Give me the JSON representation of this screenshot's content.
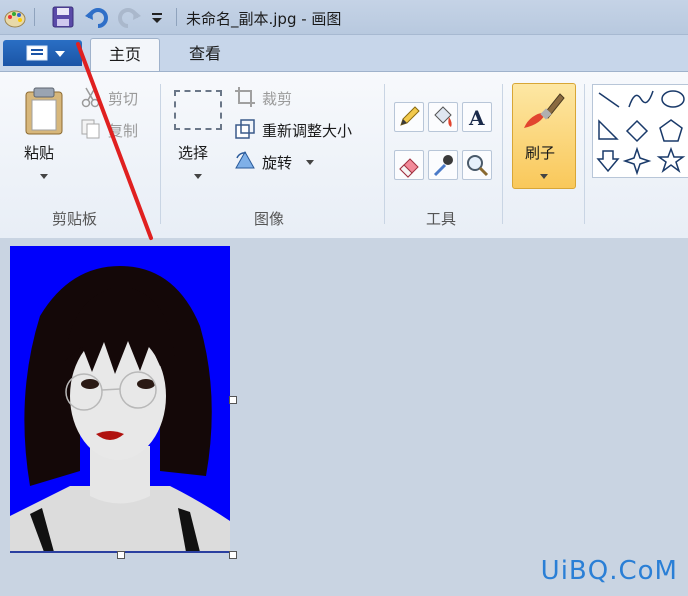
{
  "titlebar": {
    "title": "未命名_副本.jpg - 画图"
  },
  "tabs": {
    "home": "主页",
    "view": "查看"
  },
  "clipboard": {
    "paste": "粘贴",
    "cut": "剪切",
    "copy": "复制",
    "group_label": "剪贴板"
  },
  "image": {
    "select": "选择",
    "crop": "裁剪",
    "resize": "重新调整大小",
    "rotate": "旋转",
    "group_label": "图像"
  },
  "tools": {
    "group_label": "工具"
  },
  "brushes": {
    "label": "刷子"
  },
  "watermark": "UiBQ.CoM",
  "colors": {
    "canvas_background": "#0000fc",
    "brush_highlight": "#f9c85a",
    "app_menu": "#1b54a6",
    "annotation_arrow": "#e02020"
  },
  "icons": {
    "app": "paint-app-icon",
    "save": "save-icon",
    "undo": "undo-icon",
    "redo": "redo-icon",
    "customize": "customize-dropdown-icon",
    "pencil": "pencil-icon",
    "fill": "fill-bucket-icon",
    "text": "text-icon",
    "eraser": "eraser-icon",
    "color_picker": "color-picker-icon",
    "magnifier": "magnifier-icon"
  }
}
